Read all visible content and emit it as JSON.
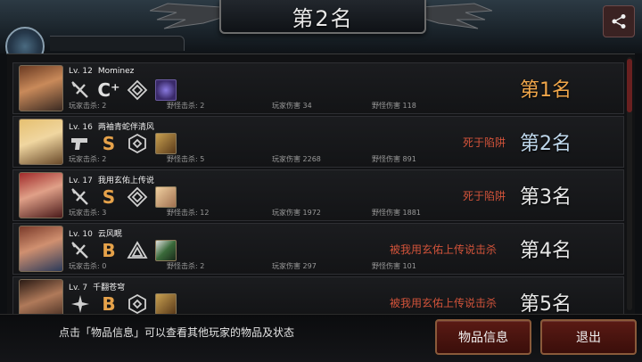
{
  "header": {
    "title": "第2名"
  },
  "rows": [
    {
      "level": "Lv. 12",
      "name": "Mominez",
      "grade": "C⁺",
      "player_kills": "玩家击杀: 2",
      "monster_kills": "野怪击杀: 2",
      "player_damage": "玩家伤害 34",
      "monster_damage": "野怪伤害 118",
      "death": "",
      "rank": "第1名"
    },
    {
      "level": "Lv. 16",
      "name": "两袖青蛇伴清风",
      "grade": "S",
      "player_kills": "玩家击杀: 2",
      "monster_kills": "野怪击杀: 5",
      "player_damage": "玩家伤害 2268",
      "monster_damage": "野怪伤害 891",
      "death": "死于陷阱",
      "rank": "第2名"
    },
    {
      "level": "Lv. 17",
      "name": "我用玄佑上传说",
      "grade": "S",
      "player_kills": "玩家击杀: 3",
      "monster_kills": "野怪击杀: 12",
      "player_damage": "玩家伤害 1972",
      "monster_damage": "野怪伤害 1881",
      "death": "死于陷阱",
      "rank": "第3名"
    },
    {
      "level": "Lv. 10",
      "name": "云风眠",
      "grade": "B",
      "player_kills": "玩家击杀: 0",
      "monster_kills": "野怪击杀: 2",
      "player_damage": "玩家伤害 297",
      "monster_damage": "野怪伤害 101",
      "death": "被我用玄佑上传说击杀",
      "rank": "第4名"
    },
    {
      "level": "Lv. 7",
      "name": "千翻苍穹",
      "grade": "B",
      "player_kills": "",
      "monster_kills": "",
      "player_damage": "",
      "monster_damage": "",
      "death": "被我用玄佑上传说击杀",
      "rank": "第5名"
    }
  ],
  "footer": {
    "hint": "点击「物品信息」可以查看其他玩家的物品及状态",
    "item_info_button": "物品信息",
    "exit_button": "退出"
  },
  "icons": {
    "share": "share-icon",
    "weapon_blade": "blade-weapon-icon",
    "weapon_pistol": "pistol-weapon-icon",
    "weapon_shuriken": "shuriken-weapon-icon",
    "armor_diamond": "diamond-armor-icon",
    "armor_hex": "hexagon-armor-icon",
    "armor_triangle": "triangle-armor-icon"
  },
  "colors": {
    "rank_first": "#f0a64a",
    "death_text": "#d2533a",
    "grade_s": "#e6a24a",
    "button_bg": "#5a1a14"
  }
}
